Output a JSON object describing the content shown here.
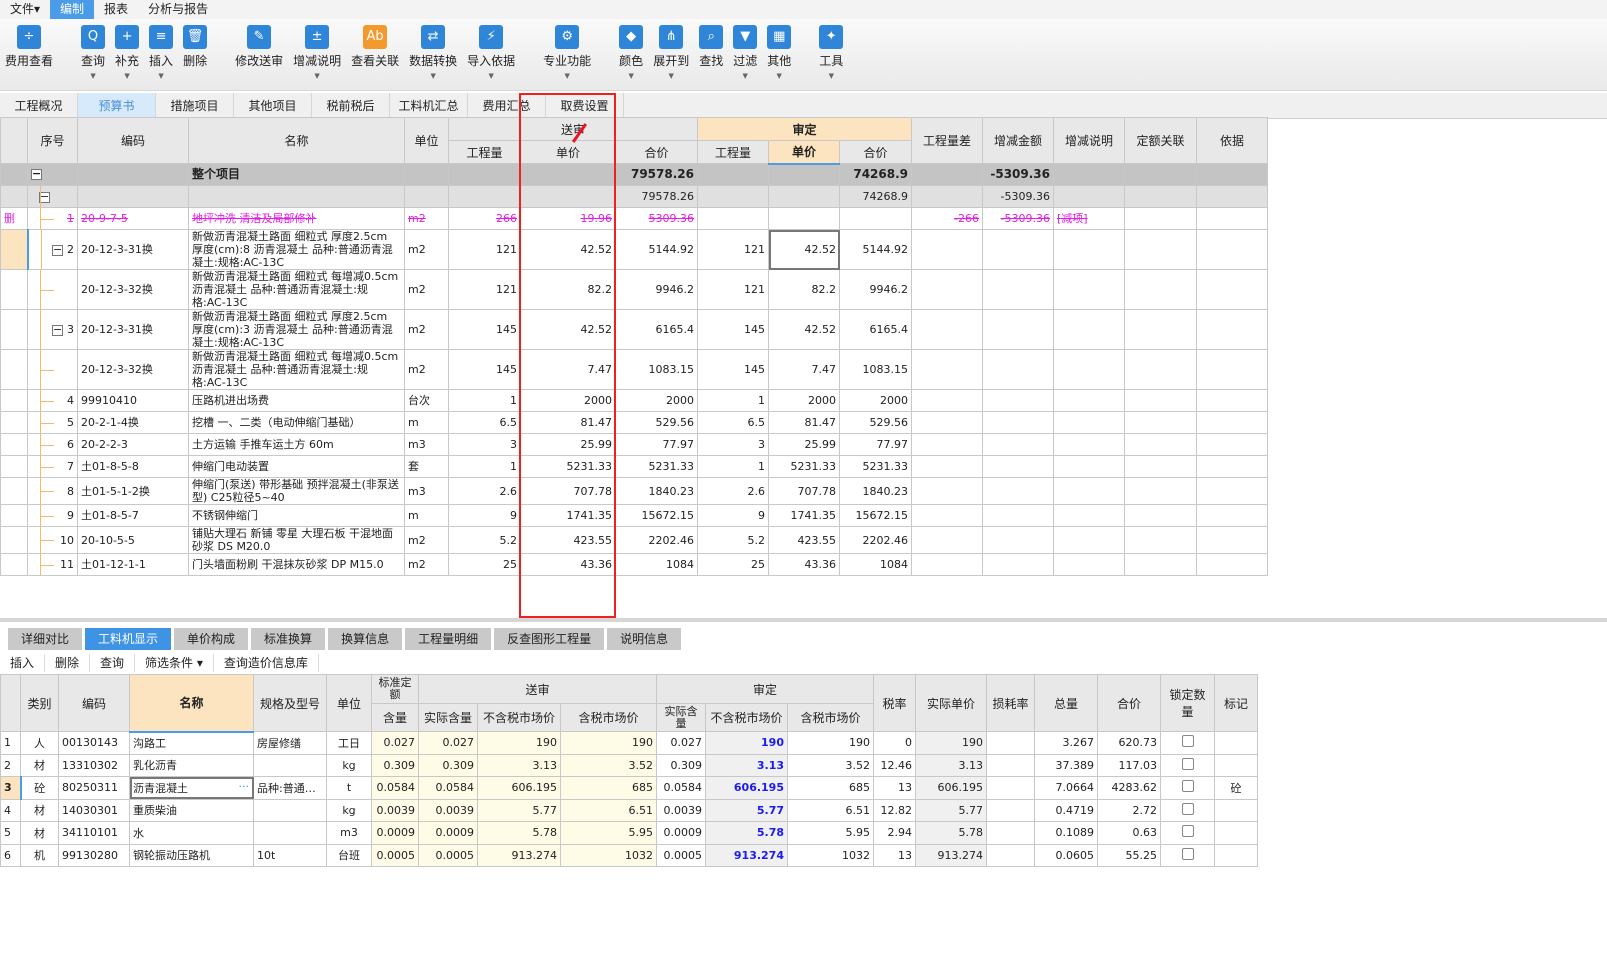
{
  "menu": [
    "文件▾",
    "编制",
    "报表",
    "分析与报告"
  ],
  "ribbon": [
    {
      "label": "费用查看",
      "icon": "fee-view-icon",
      "g": "÷"
    },
    {
      "gap": true
    },
    {
      "label": "查询",
      "icon": "query-icon",
      "g": "Q",
      "dd": true
    },
    {
      "label": "补充",
      "icon": "supplement-icon",
      "g": "+",
      "dd": true
    },
    {
      "label": "插入",
      "icon": "insert-icon",
      "g": "≡",
      "dd": true
    },
    {
      "label": "删除",
      "icon": "delete-icon",
      "g": "🗑"
    },
    {
      "gap": true
    },
    {
      "label": "修改送审",
      "icon": "edit-submit-icon",
      "g": "✎"
    },
    {
      "label": "增减说明",
      "icon": "change-note-icon",
      "g": "±",
      "dd": true
    },
    {
      "label": "查看关联",
      "icon": "view-relation-icon",
      "g": "Ab",
      "o": true
    },
    {
      "label": "数据转换",
      "icon": "data-convert-icon",
      "g": "⇄",
      "dd": true
    },
    {
      "label": "导入依据",
      "icon": "import-basis-icon",
      "g": "⚡",
      "dd": true
    },
    {
      "gap": true
    },
    {
      "label": "专业功能",
      "icon": "professional-icon",
      "g": "⚙",
      "dd": true
    },
    {
      "gap": true
    },
    {
      "label": "颜色",
      "icon": "color-icon",
      "g": "◆",
      "dd": true
    },
    {
      "label": "展开到",
      "icon": "expand-to-icon",
      "g": "⋔",
      "dd": true
    },
    {
      "label": "查找",
      "icon": "find-icon",
      "g": "⌕"
    },
    {
      "label": "过滤",
      "icon": "filter-icon",
      "g": "▼",
      "dd": true
    },
    {
      "label": "其他",
      "icon": "other-icon",
      "g": "▦",
      "dd": true
    },
    {
      "gap": true
    },
    {
      "label": "工具",
      "icon": "tools-icon",
      "g": "✦",
      "dd": true
    }
  ],
  "tabs": [
    "工程概况",
    "预算书",
    "措施项目",
    "其他项目",
    "税前税后",
    "工料机汇总",
    "费用汇总",
    "取费设置"
  ],
  "tabs_selected": 1,
  "top_headers": {
    "seq": "序号",
    "code": "编码",
    "name": "名称",
    "unit": "单位",
    "submit": "送审",
    "approved": "审定",
    "qty": "工程量",
    "price": "单价",
    "total": "合价",
    "qty_diff": "工程量差",
    "amt_diff": "增减金额",
    "note": "增减说明",
    "quota": "定额关联",
    "basis": "依据"
  },
  "top_rows": [
    {
      "type": "total",
      "name": "整个项目",
      "ss_total": "79578.26",
      "sd_total": "74268.9",
      "amt_diff": "-5309.36"
    },
    {
      "type": "sub",
      "ss_total": "79578.26",
      "sd_total": "74268.9",
      "amt_diff": "-5309.36"
    },
    {
      "type": "del",
      "mark": "删",
      "seq": "1",
      "code": "20-9-7-5",
      "name": "地坪冲洗 清洁及局部修补",
      "unit": "m2",
      "ss_qty": "266",
      "ss_price": "19.96",
      "ss_total": "5309.36",
      "qty_diff": "-266",
      "amt_diff": "-5309.36",
      "note": "[减项]"
    },
    {
      "type": "item",
      "box": true,
      "seq": "2",
      "code": "20-12-3-31换",
      "name": "新做沥青混凝土路面 细粒式 厚度2.5cm  厚度(cm):8 沥青混凝土 品种:普通沥青混凝土:规格:AC-13C",
      "unit": "m2",
      "ss_qty": "121",
      "ss_price": "42.52",
      "ss_total": "5144.92",
      "sd_qty": "121",
      "sd_price": "42.52",
      "sd_total": "5144.92",
      "current": true
    },
    {
      "type": "item",
      "child": true,
      "code": "20-12-3-32换",
      "name": "新做沥青混凝土路面 细粒式 每增减0.5cm   沥青混凝土 品种:普通沥青混凝土:规格:AC-13C",
      "unit": "m2",
      "ss_qty": "121",
      "ss_price": "82.2",
      "ss_total": "9946.2",
      "sd_qty": "121",
      "sd_price": "82.2",
      "sd_total": "9946.2"
    },
    {
      "type": "item",
      "box": true,
      "seq": "3",
      "code": "20-12-3-31换",
      "name": "新做沥青混凝土路面 细粒式 厚度2.5cm  厚度(cm):3 沥青混凝土 品种:普通沥青混凝土:规格:AC-13C",
      "unit": "m2",
      "ss_qty": "145",
      "ss_price": "42.52",
      "ss_total": "6165.4",
      "sd_qty": "145",
      "sd_price": "42.52",
      "sd_total": "6165.4"
    },
    {
      "type": "item",
      "child": true,
      "code": "20-12-3-32换",
      "name": "新做沥青混凝土路面 细粒式 每增减0.5cm 沥青混凝土 品种:普通沥青混凝土:规格:AC-13C",
      "unit": "m2",
      "ss_qty": "145",
      "ss_price": "7.47",
      "ss_total": "1083.15",
      "sd_qty": "145",
      "sd_price": "7.47",
      "sd_total": "1083.15"
    },
    {
      "type": "item",
      "seq": "4",
      "code": "99910410",
      "name": "压路机进出场费",
      "unit": "台次",
      "ss_qty": "1",
      "ss_price": "2000",
      "ss_total": "2000",
      "sd_qty": "1",
      "sd_price": "2000",
      "sd_total": "2000"
    },
    {
      "type": "item",
      "seq": "5",
      "code": "20-2-1-4换",
      "name": "挖槽 一、二类（电动伸缩门基础）",
      "unit": "m",
      "ss_qty": "6.5",
      "ss_price": "81.47",
      "ss_total": "529.56",
      "sd_qty": "6.5",
      "sd_price": "81.47",
      "sd_total": "529.56"
    },
    {
      "type": "item",
      "seq": "6",
      "code": "20-2-2-3",
      "name": "土方运输 手推车运土方 60m",
      "unit": "m3",
      "ss_qty": "3",
      "ss_price": "25.99",
      "ss_total": "77.97",
      "sd_qty": "3",
      "sd_price": "25.99",
      "sd_total": "77.97"
    },
    {
      "type": "item",
      "seq": "7",
      "code": "土01-8-5-8",
      "name": "伸缩门电动装置",
      "unit": "套",
      "ss_qty": "1",
      "ss_price": "5231.33",
      "ss_total": "5231.33",
      "sd_qty": "1",
      "sd_price": "5231.33",
      "sd_total": "5231.33"
    },
    {
      "type": "item",
      "seq": "8",
      "code": "土01-5-1-2换",
      "name": "伸缩门(泵送) 带形基础   预拌混凝土(非泵送型) C25粒径5~40",
      "unit": "m3",
      "ss_qty": "2.6",
      "ss_price": "707.78",
      "ss_total": "1840.23",
      "sd_qty": "2.6",
      "sd_price": "707.78",
      "sd_total": "1840.23"
    },
    {
      "type": "item",
      "seq": "9",
      "code": "土01-8-5-7",
      "name": "不锈钢伸缩门",
      "unit": "m",
      "ss_qty": "9",
      "ss_price": "1741.35",
      "ss_total": "15672.15",
      "sd_qty": "9",
      "sd_price": "1741.35",
      "sd_total": "15672.15"
    },
    {
      "type": "item",
      "seq": "10",
      "code": "20-10-5-5",
      "name": "铺贴大理石 新铺 零星 大理石板  干混地面砂浆 DS M20.0",
      "unit": "m2",
      "ss_qty": "5.2",
      "ss_price": "423.55",
      "ss_total": "2202.46",
      "sd_qty": "5.2",
      "sd_price": "423.55",
      "sd_total": "2202.46"
    },
    {
      "type": "item",
      "seq": "11",
      "code": "土01-12-1-1",
      "name": "门头墙面粉刷 干混抹灰砂浆 DP M15.0",
      "unit": "m2",
      "ss_qty": "25",
      "ss_price": "43.36",
      "ss_total": "1084",
      "sd_qty": "25",
      "sd_price": "43.36",
      "sd_total": "1084"
    }
  ],
  "bottom_tabs": [
    "详细对比",
    "工料机显示",
    "单价构成",
    "标准换算",
    "换算信息",
    "工程量明细",
    "反查图形工程量",
    "说明信息"
  ],
  "bottom_tabs_selected": 1,
  "bottom_toolbar": [
    "插入",
    "删除",
    "查询",
    "筛选条件 ▾",
    "查询造价信息库"
  ],
  "bot_headers": {
    "cat": "类别",
    "code": "编码",
    "name": "名称",
    "spec": "规格及型号",
    "unit": "单位",
    "std": "标准定额",
    "submit": "送审",
    "approved": "审定",
    "content": "含量",
    "act_content": "实际含量",
    "notax": "不含税市场价",
    "tax": "含税市场价",
    "sd_act_content": "实际含量",
    "rate": "税率",
    "act_price": "实际单价",
    "loss": "损耗率",
    "total_qty": "总量",
    "total": "合价",
    "lock": "锁定数量",
    "mark": "标记"
  },
  "bot_rows": [
    {
      "i": "1",
      "cat": "人",
      "code": "00130143",
      "name": "沟路工",
      "spec": "房屋修缮",
      "unit": "工日",
      "c": "0.027",
      "ac": "0.027",
      "nt": "190",
      "t": "190",
      "sac": "0.027",
      "snt": "190",
      "st": "190",
      "rate": "0",
      "ap": "190",
      "loss": "",
      "tq": "3.267",
      "tot": "620.73",
      "mark": ""
    },
    {
      "i": "2",
      "cat": "材",
      "code": "13310302",
      "name": "乳化沥青",
      "spec": "",
      "unit": "kg",
      "c": "0.309",
      "ac": "0.309",
      "nt": "3.13",
      "t": "3.52",
      "sac": "0.309",
      "snt": "3.13",
      "st": "3.52",
      "rate": "12.46",
      "ap": "3.13",
      "loss": "",
      "tq": "37.389",
      "tot": "117.03",
      "mark": ""
    },
    {
      "i": "3",
      "cat": "砼",
      "code": "80250311",
      "name": "沥青混凝土",
      "spec": "品种:普通…",
      "unit": "t",
      "c": "0.0584",
      "ac": "0.0584",
      "nt": "606.195",
      "t": "685",
      "sac": "0.0584",
      "snt": "606.195",
      "st": "685",
      "rate": "13",
      "ap": "606.195",
      "loss": "",
      "tq": "7.0664",
      "tot": "4283.62",
      "mark": "砼",
      "current": true
    },
    {
      "i": "4",
      "cat": "材",
      "code": "14030301",
      "name": "重质柴油",
      "spec": "",
      "unit": "kg",
      "c": "0.0039",
      "ac": "0.0039",
      "nt": "5.77",
      "t": "6.51",
      "sac": "0.0039",
      "snt": "5.77",
      "st": "6.51",
      "rate": "12.82",
      "ap": "5.77",
      "loss": "",
      "tq": "0.4719",
      "tot": "2.72",
      "mark": ""
    },
    {
      "i": "5",
      "cat": "材",
      "code": "34110101",
      "name": "水",
      "spec": "",
      "unit": "m3",
      "c": "0.0009",
      "ac": "0.0009",
      "nt": "5.78",
      "t": "5.95",
      "sac": "0.0009",
      "snt": "5.78",
      "st": "5.95",
      "rate": "2.94",
      "ap": "5.78",
      "loss": "",
      "tq": "0.1089",
      "tot": "0.63",
      "mark": ""
    },
    {
      "i": "6",
      "cat": "机",
      "code": "99130280",
      "name": "钢轮振动压路机",
      "spec": "10t",
      "unit": "台班",
      "c": "0.0005",
      "ac": "0.0005",
      "nt": "913.274",
      "t": "1032",
      "sac": "0.0005",
      "snt": "913.274",
      "st": "1032",
      "rate": "13",
      "ap": "913.274",
      "loss": "",
      "tq": "0.0605",
      "tot": "55.25",
      "mark": ""
    }
  ],
  "colors": {
    "accent": "#3f93e4",
    "deleted": "#e020e0",
    "highlight": "#fde4c0",
    "annotation": "#f21f1f",
    "approved_price": "#1b1bef"
  }
}
